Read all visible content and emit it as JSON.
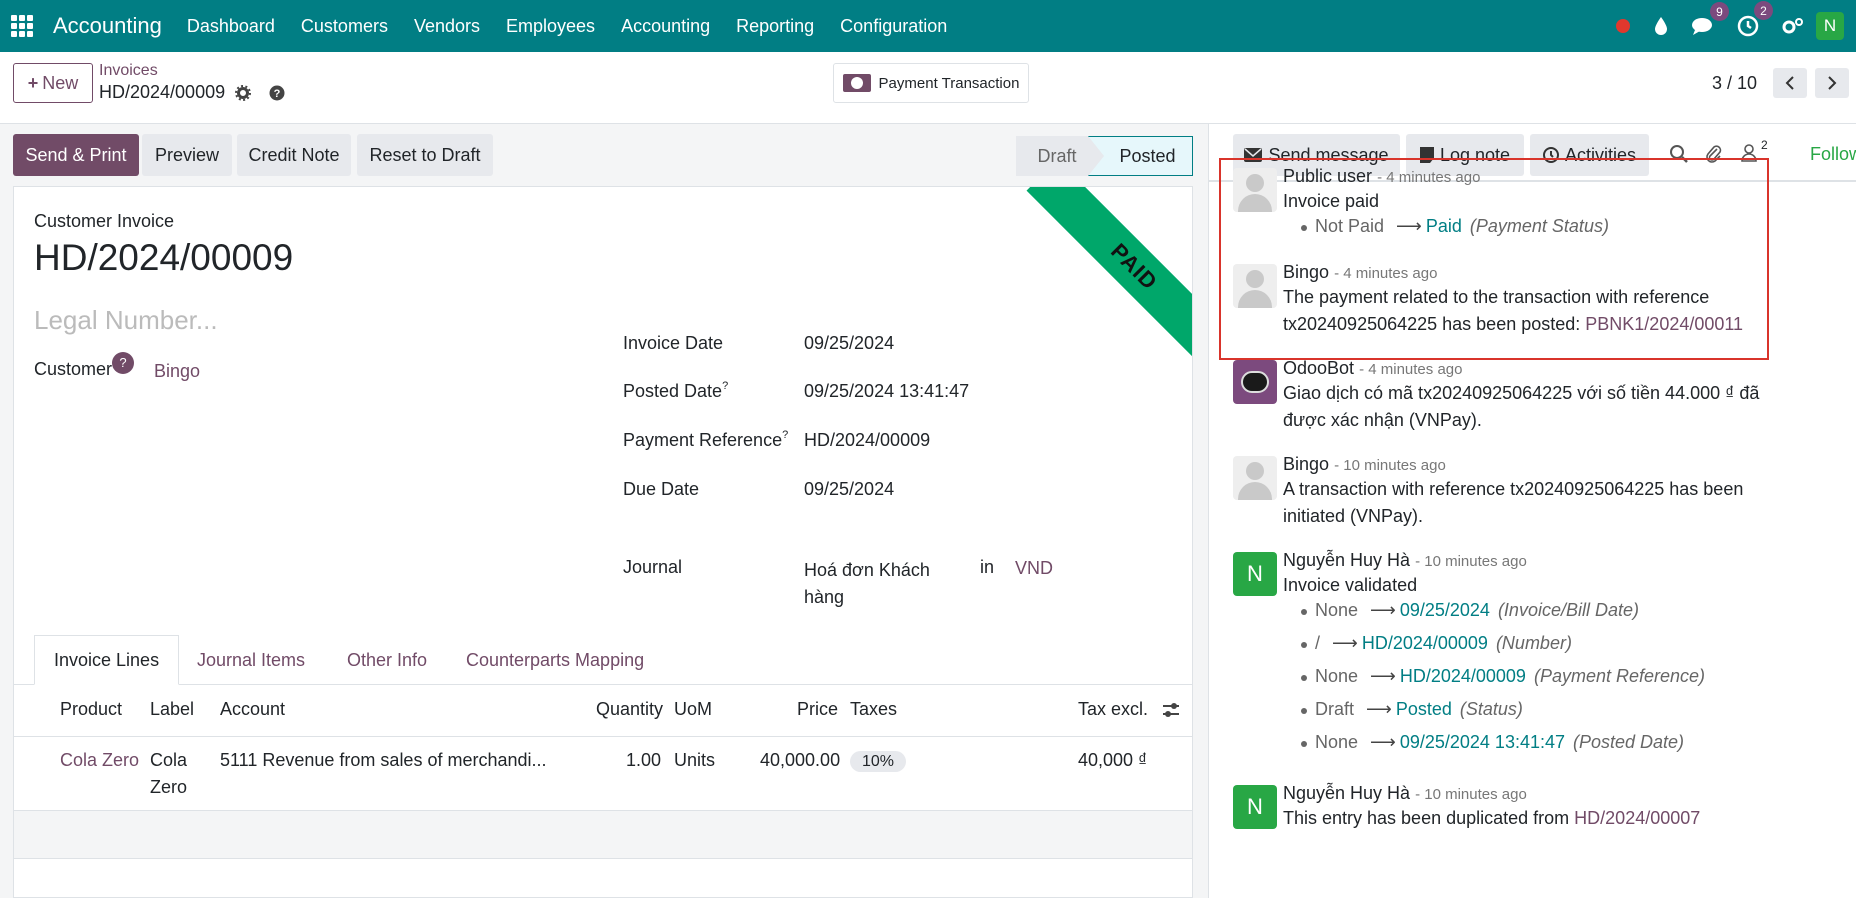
{
  "navbar": {
    "brand": "Accounting",
    "menu": [
      "Dashboard",
      "Customers",
      "Vendors",
      "Employees",
      "Accounting",
      "Reporting",
      "Configuration"
    ],
    "messages_badge": "9",
    "activities_badge": "2",
    "user_initial": "N"
  },
  "control": {
    "new_label": "New",
    "breadcrumb_parent": "Invoices",
    "breadcrumb_current": "HD/2024/00009",
    "payment_transaction_label": "Payment Transaction",
    "pager": "3 / 10"
  },
  "statusbar": {
    "send_print": "Send & Print",
    "preview": "Preview",
    "credit_note": "Credit Note",
    "reset_to_draft": "Reset to Draft",
    "stage_draft": "Draft",
    "stage_posted": "Posted"
  },
  "invoice": {
    "ribbon": "PAID",
    "doc_type": "Customer Invoice",
    "number": "HD/2024/00009",
    "legal_placeholder": "Legal Number...",
    "customer_label": "Customer",
    "customer_help": "?",
    "customer_value": "Bingo",
    "fields": {
      "invoice_date_label": "Invoice Date",
      "invoice_date": "09/25/2024",
      "posted_date_label": "Posted Date",
      "posted_date": "09/25/2024 13:41:47",
      "payment_ref_label": "Payment Reference",
      "payment_ref": "HD/2024/00009",
      "due_date_label": "Due Date",
      "due_date": "09/25/2024",
      "journal_label": "Journal",
      "journal_line1": "Hoá đơn Khách",
      "journal_line2": "hàng",
      "journal_in": "in",
      "journal_currency": "VND",
      "help_mark": "?"
    },
    "tabs": [
      "Invoice Lines",
      "Journal Items",
      "Other Info",
      "Counterparts Mapping"
    ],
    "columns": {
      "product": "Product",
      "label": "Label",
      "account": "Account",
      "quantity": "Quantity",
      "uom": "UoM",
      "price": "Price",
      "taxes": "Taxes",
      "tax_excl": "Tax excl."
    },
    "line": {
      "product": "Cola Zero",
      "label_1": "Cola",
      "label_2": "Zero",
      "account": "5111 Revenue from sales of merchandi...",
      "quantity": "1.00",
      "uom": "Units",
      "price": "40,000.00",
      "tax": "10%",
      "subtotal": "40,000 ₫"
    }
  },
  "chatter": {
    "send_message": "Send message",
    "log_note": "Log note",
    "activities": "Activities",
    "followers_count": "2",
    "follow": "Follow",
    "messages": [
      {
        "author": "Public user",
        "date": "- 4 minutes ago",
        "body": "Invoice paid",
        "change": {
          "old": "Not Paid",
          "arrow": "⟶",
          "new": "Paid",
          "field": "(Payment Status)"
        }
      },
      {
        "author": "Bingo",
        "date": "- 4 minutes ago",
        "body_1": "The payment related to the transaction with reference",
        "body_2": "tx20240925064225 has been posted:",
        "link": "PBNK1/2024/00011"
      },
      {
        "author": "OdooBot",
        "date": "- 4 minutes ago",
        "body_1": "Giao dịch có mã tx20240925064225 với số tiền 44.000 ₫ đã",
        "body_2": "được xác nhận (VNPay)."
      },
      {
        "author": "Bingo",
        "date": "- 10 minutes ago",
        "body_1": "A transaction with reference tx20240925064225 has been",
        "body_2": "initiated (VNPay)."
      },
      {
        "author": "Nguyễn Huy Hà",
        "date": "- 10 minutes ago",
        "initial": "N",
        "body": "Invoice validated",
        "changes": [
          {
            "old": "None",
            "new": "09/25/2024",
            "field": "(Invoice/Bill Date)"
          },
          {
            "old": "/",
            "new": "HD/2024/00009",
            "field": "(Number)"
          },
          {
            "old": "None",
            "new": "HD/2024/00009",
            "field": "(Payment Reference)"
          },
          {
            "old": "Draft",
            "new": "Posted",
            "field": "(Status)"
          },
          {
            "old": "None",
            "new": "09/25/2024 13:41:47",
            "field": "(Posted Date)"
          }
        ]
      },
      {
        "author": "Nguyễn Huy Hà",
        "date": "- 10 minutes ago",
        "initial": "N",
        "body": "This entry has been duplicated from",
        "link": "HD/2024/00007"
      }
    ],
    "arrow": "⟶"
  },
  "colors": {
    "navbar": "#017e84",
    "brand_purple": "#714b67",
    "paid_ribbon": "#00a76a",
    "highlight": "#d9342b"
  }
}
